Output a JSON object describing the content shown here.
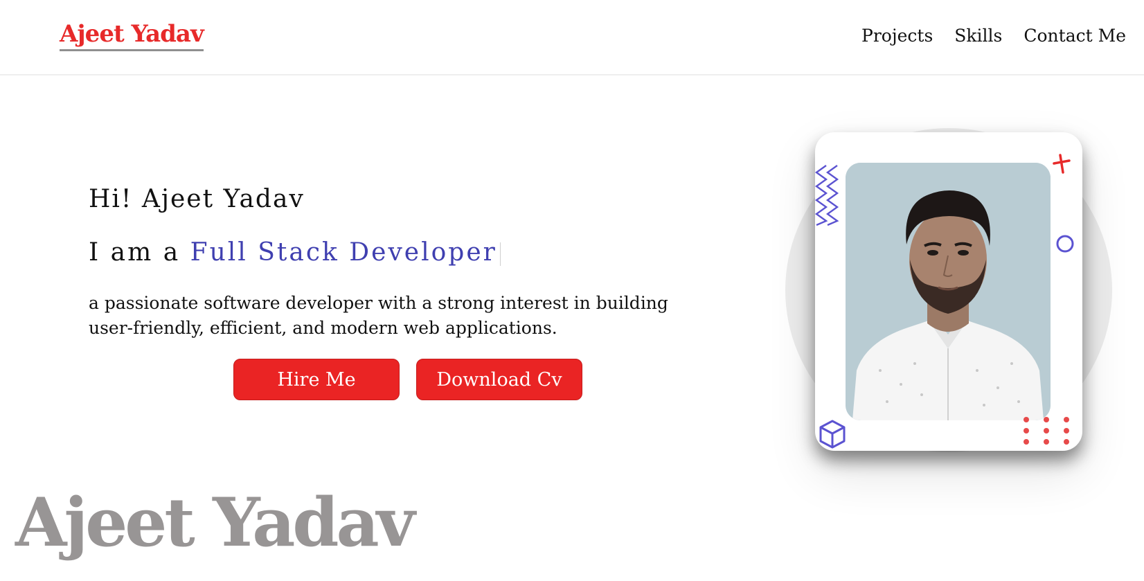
{
  "header": {
    "logo": "Ajeet Yadav",
    "nav": [
      "Projects",
      "Skills",
      "Contact Me"
    ]
  },
  "hero": {
    "greeting": "Hi! Ajeet Yadav",
    "role_prefix": "I am a ",
    "role_highlight": "Full Stack Developer",
    "description": "a passionate software developer with a strong interest in building user-friendly, efficient, and modern web applications.",
    "buttons": {
      "hire": "Hire Me",
      "cv": "Download Cv"
    },
    "watermark": "Ajeet Yadav"
  },
  "profile": {
    "photo": "portrait-photo",
    "decorations": [
      "zigzag-icon",
      "plus-icon",
      "circle-icon",
      "cube-icon",
      "dots-grid-icon"
    ]
  },
  "colors": {
    "accent_red": "#e72a2a",
    "highlight_blue": "#3f3fb0",
    "decor_blue": "#5b53d1",
    "watermark_gray": "#989595"
  }
}
